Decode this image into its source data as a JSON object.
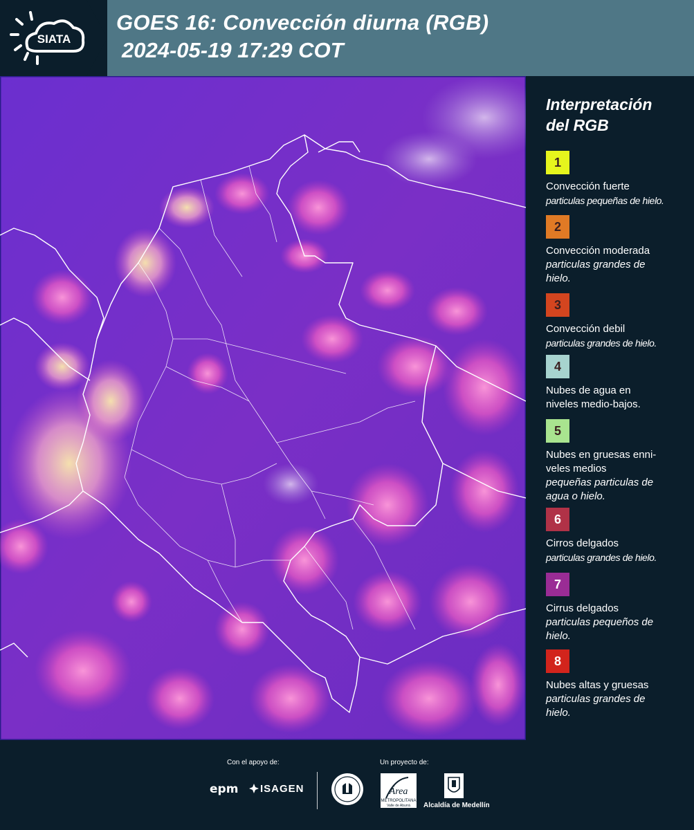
{
  "header": {
    "logo_text": "SIATA",
    "title": "GOES 16: Convección diurna (RGB)",
    "subtitle": "2024-05-19 17:29 COT"
  },
  "legend": {
    "title_line1": "Interpretación",
    "title_line2": "del RGB",
    "items": [
      {
        "number": "1",
        "color": "#e6f51d",
        "label_lines": [
          "Convección fuerte"
        ],
        "sub_lines": [
          "particulas pequeñas de hielo."
        ]
      },
      {
        "number": "2",
        "color": "#e07a25",
        "label_lines": [
          "Convección moderada"
        ],
        "sub_lines": [
          "particulas grandes de",
          "hielo."
        ]
      },
      {
        "number": "3",
        "color": "#d4451f",
        "label_lines": [
          "Convección debil"
        ],
        "sub_lines": [
          "particulas grandes de hielo."
        ]
      },
      {
        "number": "4",
        "color": "#a7d3cf",
        "label_lines": [
          "Nubes de agua en",
          "niveles medio-bajos."
        ],
        "sub_lines": []
      },
      {
        "number": "5",
        "color": "#a9e48f",
        "label_lines": [
          "Nubes en gruesas enni-",
          "veles medios"
        ],
        "sub_lines": [
          "pequeñas particulas de",
          "agua o hielo."
        ]
      },
      {
        "number": "6",
        "color": "#b03247",
        "label_lines": [
          "Cirros delgados"
        ],
        "sub_lines": [
          "particulas grandes de hielo."
        ]
      },
      {
        "number": "7",
        "color": "#9a2c95",
        "label_lines": [
          "Cirrus delgados"
        ],
        "sub_lines": [
          "particulas pequeños de",
          "hielo."
        ]
      },
      {
        "number": "8",
        "color": "#d2241c",
        "label_lines": [
          "Nubes altas y gruesas"
        ],
        "sub_lines": [
          "particulas grandes de",
          "hielo."
        ]
      }
    ]
  },
  "footer": {
    "support_label": "Con el apoyo de:",
    "project_label": "Un proyecto de:",
    "sponsor1": "epm",
    "sponsor2": "ISAGEN",
    "partner_area_line1": "METROPOLITANA",
    "partner_area_line2": "Valle de Aburrá",
    "partner_area_name": "Área",
    "partner_alcaldia": "Alcaldía de Medellín"
  },
  "colors": {
    "header_bg": "#4f7786",
    "panel_bg": "#0b1e2b",
    "map_base": "#6a2bc9",
    "cloud_pink": "#f25dc4",
    "cloud_yellow": "#f7e49a"
  }
}
